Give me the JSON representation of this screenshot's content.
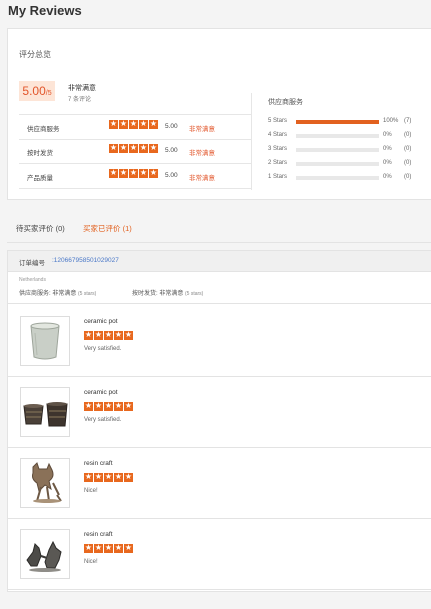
{
  "page": {
    "title": "My Reviews"
  },
  "summary": {
    "heading": "评分总览",
    "score": "5.00",
    "score_suffix": "/5",
    "score_text": "非常满意",
    "review_count": "7 条评论",
    "ratings": [
      {
        "label": "供应商服务",
        "stars": 5,
        "value": "5.00",
        "tag": "非常满意"
      },
      {
        "label": "按时发货",
        "stars": 5,
        "value": "5.00",
        "tag": "非常满意"
      },
      {
        "label": "产品质量",
        "stars": 5,
        "value": "5.00",
        "tag": "非常满意"
      }
    ],
    "distribution_title": "供应商服务",
    "distribution": [
      {
        "label": "5 Stars",
        "fraction": 1.0,
        "percent": "100%",
        "count": "(7)"
      },
      {
        "label": "4 Stars",
        "fraction": 0.0,
        "percent": "0%",
        "count": "(0)"
      },
      {
        "label": "3 Stars",
        "fraction": 0.0,
        "percent": "0%",
        "count": "(0)"
      },
      {
        "label": "2 Stars",
        "fraction": 0.0,
        "percent": "0%",
        "count": "(0)"
      },
      {
        "label": "1 Stars",
        "fraction": 0.0,
        "percent": "0%",
        "count": "(0)"
      }
    ]
  },
  "tabs": {
    "pending": "待买家评价 (0)",
    "done": "买家已评价 (1)"
  },
  "order": {
    "number_label": "订单编号",
    "number": ":120667958501029027",
    "country": "Netherlands",
    "supplier_rating": "供应商服务: 非常满意",
    "supplier_rating_small": "(5 stars)",
    "shipping_rating": "按时发货: 非常满意",
    "shipping_rating_small": "(5 stars)"
  },
  "items": [
    {
      "name": "ceramic pot",
      "stars": 5,
      "comment": "Very satisfied."
    },
    {
      "name": "ceramic pot",
      "stars": 5,
      "comment": "Very satisfied."
    },
    {
      "name": "resin craft",
      "stars": 5,
      "comment": "Nice!"
    },
    {
      "name": "resin craft",
      "stars": 5,
      "comment": "Nice!"
    }
  ],
  "colors": {
    "accent": "#e2611f",
    "link": "#4a78c8",
    "score_bg": "#fde5d7"
  },
  "icons": {
    "star": "star-icon"
  }
}
